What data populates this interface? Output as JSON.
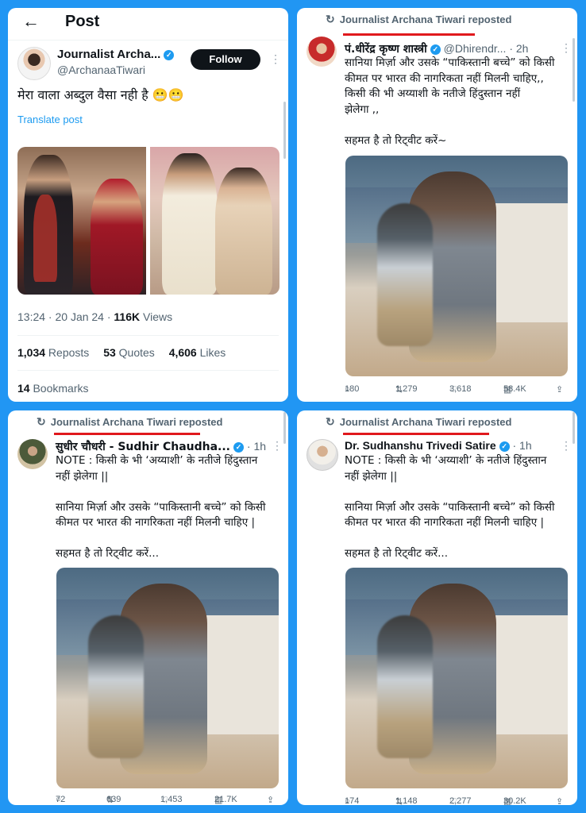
{
  "post": {
    "back_icon": "arrow-left-icon",
    "title": "Post",
    "author_name": "Journalist Archa...",
    "author_handle": "@ArchanaaTiwari",
    "follow_label": "Follow",
    "menu": "⋮",
    "text": "मेरा वाला अब्दुल वैसा नही है 😬😬",
    "translate": "Translate post",
    "meta_time": "13:24 · 20 Jan 24 · ",
    "views_count": "116K",
    "views_label": " Views",
    "reposts_count": "1,034",
    "reposts_label": " Reposts",
    "quotes_count": "53",
    "quotes_label": " Quotes",
    "likes_count": "4,606",
    "likes_label": " Likes",
    "bookmarks_count": "14",
    "bookmarks_label": " Bookmarks"
  },
  "reposts": [
    {
      "repost_label": "Journalist Archana Tiwari reposted",
      "name": "पं.धीरेंद्र कृष्ण शास्त्री",
      "handle": "@Dhirendr...",
      "time": "· 2h",
      "lines": [
        "सानिया मिर्ज़ा और उसके “पाकिस्तानी बच्चे” को किसी",
        "कीमत पर भारत की नागरिकता नहीं मिलनी चाहिए,,",
        "किसी की भी अय्याशी के नतीजे हिंदुस्तान नहीं",
        "झेलेगा ,,",
        "",
        "सहमत है तो रिट्वीट करें~"
      ],
      "replies": "180",
      "retweets": "1,279",
      "likes": "3,618",
      "views": "58.4K"
    },
    {
      "repost_label": "Journalist Archana Tiwari reposted",
      "name": "सुधीर चौधरी - Sudhir Chaudha...",
      "handle": "",
      "time": "· 1h",
      "lines": [
        "NOTE : किसी के भी ‘अय्याशी’ के नतीजे हिंदुस्तान",
        "नहीं झेलेगा ||",
        "",
        "सानिया मिर्ज़ा और उसके “पाकिस्तानी बच्चे” को किसी",
        "कीमत पर भारत की नागरिकता नहीं मिलनी चाहिए |",
        "",
        "सहमत है तो रिट्वीट करें..."
      ],
      "replies": "72",
      "retweets": "639",
      "likes": "1,453",
      "views": "21.7K"
    },
    {
      "repost_label": "Journalist Archana Tiwari reposted",
      "name": "Dr. Sudhanshu Trivedi Satire",
      "handle": "",
      "time": "· 1h",
      "lines": [
        "NOTE : किसी के भी ‘अय्याशी’ के नतीजे हिंदुस्तान",
        "नहीं झेलेगा ||",
        "",
        "सानिया मिर्ज़ा और उसके “पाकिस्तानी बच्चे” को किसी",
        "कीमत पर भारत की नागरिकता नहीं मिलनी चाहिए |",
        "",
        "सहमत है तो रिट्वीट करें..."
      ],
      "replies": "174",
      "retweets": "1,148",
      "likes": "2,277",
      "views": "30.2K"
    }
  ],
  "icons": {
    "repost": "↻",
    "reply": "○",
    "retweet": "⇅",
    "like": "♡",
    "views": "▥",
    "share": "⇪"
  }
}
